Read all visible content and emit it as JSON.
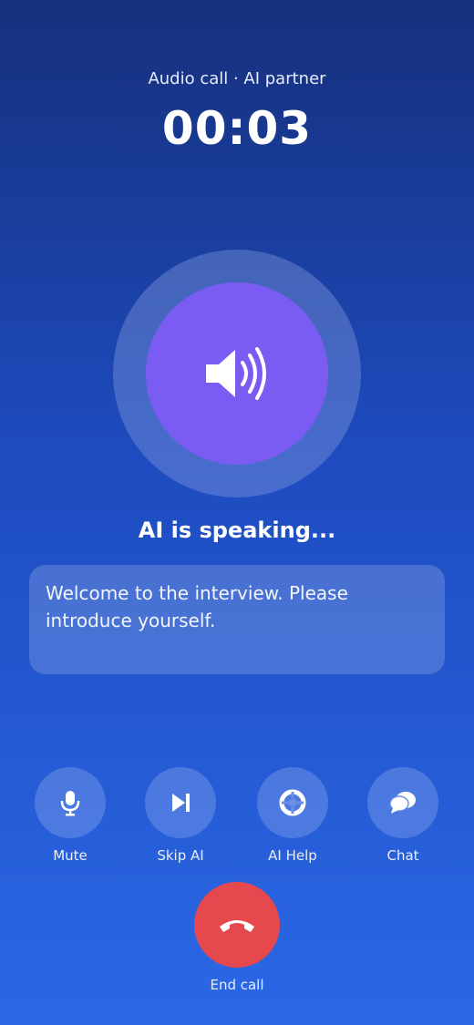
{
  "header": {
    "subtitle": "Audio call · AI partner",
    "timer": "00:03"
  },
  "speaker": {
    "icon": "speaker-volume-icon",
    "color": "#7b5cf2"
  },
  "status": {
    "text": "AI is speaking..."
  },
  "transcript": {
    "text": "Welcome to the interview. Please introduce yourself."
  },
  "controls": [
    {
      "label": "Mute",
      "icon": "microphone-icon"
    },
    {
      "label": "Skip AI",
      "icon": "skip-next-icon"
    },
    {
      "label": "AI Help",
      "icon": "lifebuoy-icon"
    },
    {
      "label": "Chat",
      "icon": "chat-bubbles-icon"
    }
  ],
  "end_call": {
    "label": "End call",
    "icon": "hang-up-icon",
    "color": "#e5484d"
  }
}
